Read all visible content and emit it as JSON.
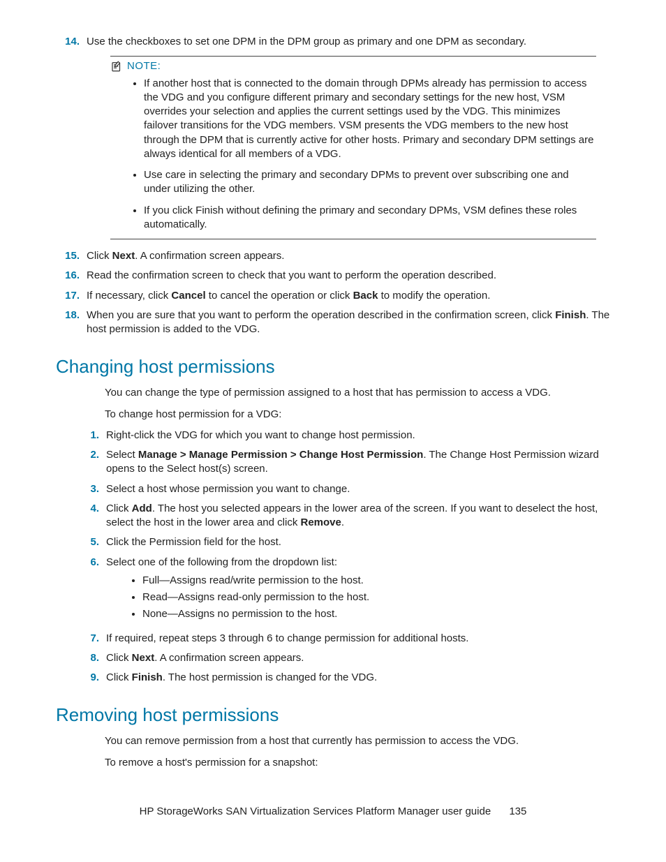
{
  "top_list": {
    "items": [
      {
        "num": "14.",
        "text": "Use the checkboxes to set one DPM in the DPM group as primary and one DPM as secondary."
      }
    ]
  },
  "note": {
    "label": "NOTE:",
    "bullets": [
      "If another host that is connected to the domain through DPMs already has permission to access the VDG and you configure different primary and secondary settings for the new host, VSM overrides your selection and applies the current settings used by the VDG. This minimizes failover transitions for the VDG members. VSM presents the VDG members to the new host through the DPM that is currently active for other hosts. Primary and secondary DPM settings are always identical for all members of a VDG.",
      "Use care in selecting the primary and secondary DPMs to prevent over subscribing one and under utilizing the other.",
      "If you click Finish without defining the primary and secondary DPMs, VSM defines these roles automatically."
    ]
  },
  "post_note_list": {
    "items": [
      {
        "num": "15.",
        "pre": "Click ",
        "b1": "Next",
        "post": ". A confirmation screen appears."
      },
      {
        "num": "16.",
        "text": "Read the confirmation screen to check that you want to perform the operation described."
      },
      {
        "num": "17.",
        "pre": "If necessary, click ",
        "b1": "Cancel",
        "mid": " to cancel the operation or click ",
        "b2": "Back",
        "post": " to modify the operation."
      },
      {
        "num": "18.",
        "pre": "When you are sure that you want to perform the operation described in the confirmation screen, click ",
        "b1": "Finish",
        "post": ". The host permission is added to the VDG."
      }
    ]
  },
  "section_changing": {
    "title": "Changing host permissions",
    "intro1": "You can change the type of permission assigned to a host that has permission to access a VDG.",
    "intro2": "To change host permission for a VDG:",
    "steps": [
      {
        "num": "1.",
        "text": "Right-click the VDG for which you want to change host permission."
      },
      {
        "num": "2.",
        "pre": "Select ",
        "b1": "Manage > Manage Permission > Change Host Permission",
        "post": ". The Change Host Permission wizard opens to the Select host(s) screen."
      },
      {
        "num": "3.",
        "text": "Select a host whose permission you want to change."
      },
      {
        "num": "4.",
        "pre": "Click ",
        "b1": "Add",
        "mid": ". The host you selected appears in the lower area of the screen. If you want to deselect the host, select the host in the lower area and click ",
        "b2": "Remove",
        "post": "."
      },
      {
        "num": "5.",
        "text": "Click the Permission field for the host."
      },
      {
        "num": "6.",
        "text": "Select one of the following from the dropdown list:",
        "subitems": [
          "Full—Assigns read/write permission to the host.",
          "Read—Assigns read-only permission to the host.",
          "None—Assigns no permission to the host."
        ]
      },
      {
        "num": "7.",
        "text": "If required, repeat steps 3 through 6 to change permission for additional hosts."
      },
      {
        "num": "8.",
        "pre": "Click ",
        "b1": "Next",
        "post": ". A confirmation screen appears."
      },
      {
        "num": "9.",
        "pre": "Click ",
        "b1": "Finish",
        "post": ". The host permission is changed for the VDG."
      }
    ]
  },
  "section_removing": {
    "title": "Removing host permissions",
    "intro1": "You can remove permission from a host that currently has permission to access the VDG.",
    "intro2": "To remove a host's permission for a snapshot:"
  },
  "footer": {
    "text": "HP StorageWorks SAN Virtualization Services Platform Manager user guide",
    "page": "135"
  }
}
